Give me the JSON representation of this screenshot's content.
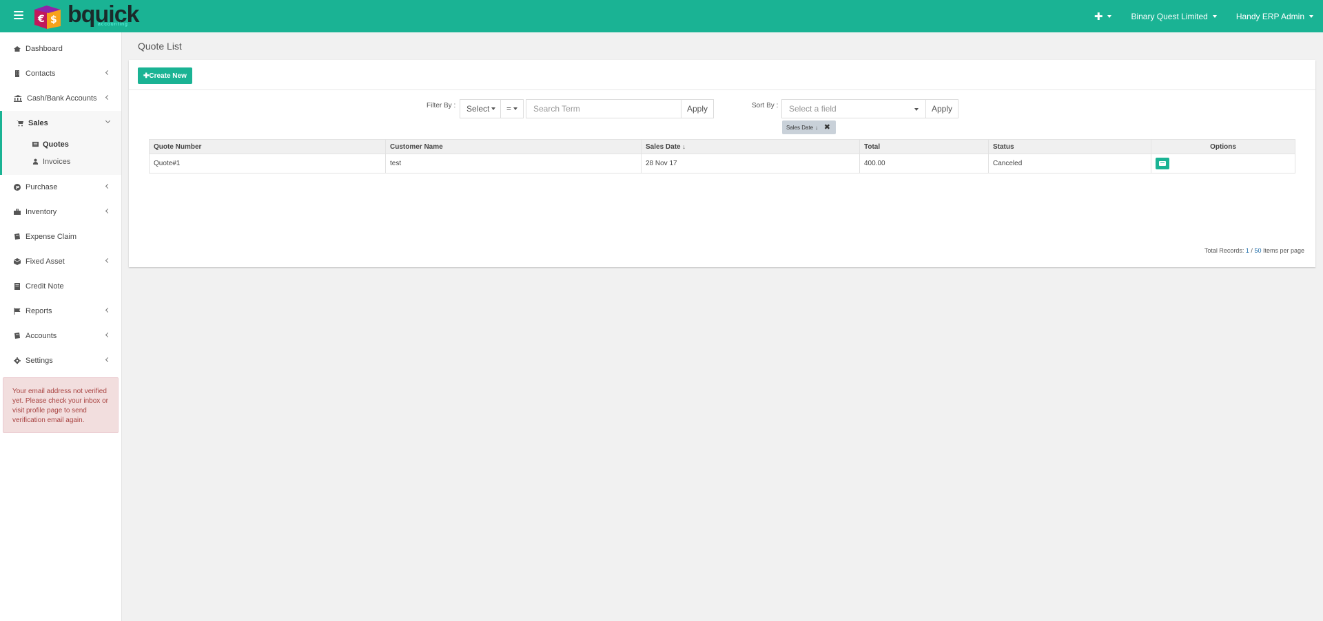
{
  "brand": {
    "name": "bquick",
    "tagline": "accounting",
    "accent": "#1ab394"
  },
  "topnav": {
    "plus": "✚",
    "company": "Binary Quest Limited",
    "user": "Handy ERP Admin"
  },
  "sidebar": {
    "items": [
      {
        "label": "Dashboard",
        "icon": "home-icon"
      },
      {
        "label": "Contacts",
        "icon": "building-icon"
      },
      {
        "label": "Cash/Bank Accounts",
        "icon": "bank-icon"
      },
      {
        "label": "Sales",
        "icon": "cart-icon"
      },
      {
        "label": "Purchase",
        "icon": "circle-p-icon"
      },
      {
        "label": "Inventory",
        "icon": "briefcase-icon"
      },
      {
        "label": "Expense Claim",
        "icon": "book-icon"
      },
      {
        "label": "Fixed Asset",
        "icon": "cube-icon"
      },
      {
        "label": "Credit Note",
        "icon": "doc-icon"
      },
      {
        "label": "Reports",
        "icon": "flag-icon"
      },
      {
        "label": "Accounts",
        "icon": "book-icon"
      },
      {
        "label": "Settings",
        "icon": "gear-icon"
      }
    ],
    "sales_sub": [
      {
        "label": "Quotes",
        "icon": "list-icon"
      },
      {
        "label": "Invoices",
        "icon": "user-icon"
      }
    ],
    "alert": "Your email address not verified yet. Please check your inbox or visit profile page to send verification email again."
  },
  "main": {
    "title": "Quote List",
    "create_label": "✚Create New",
    "filter": {
      "label": "Filter By :",
      "field": "Select",
      "operator": "=",
      "search_placeholder": "Search Term",
      "apply": "Apply"
    },
    "sort": {
      "label": "Sort By :",
      "field_placeholder": "Select a field",
      "apply": "Apply",
      "tag": "Sales Date ↓̲",
      "tag_text": "Sales Date",
      "tag_close": "✖"
    },
    "table": {
      "headers": [
        "Quote Number",
        "Customer Name",
        "Sales Date",
        "Total",
        "Status",
        "Options"
      ],
      "rows": [
        {
          "quote": "Quote#1",
          "customer": "test",
          "date": "28 Nov 17",
          "total": "400.00",
          "status": "Canceled"
        }
      ]
    },
    "footer": {
      "prefix": "Total Records: ",
      "count": "1",
      "sep": " / ",
      "per_page": "50",
      "suffix": " Items per page"
    }
  }
}
